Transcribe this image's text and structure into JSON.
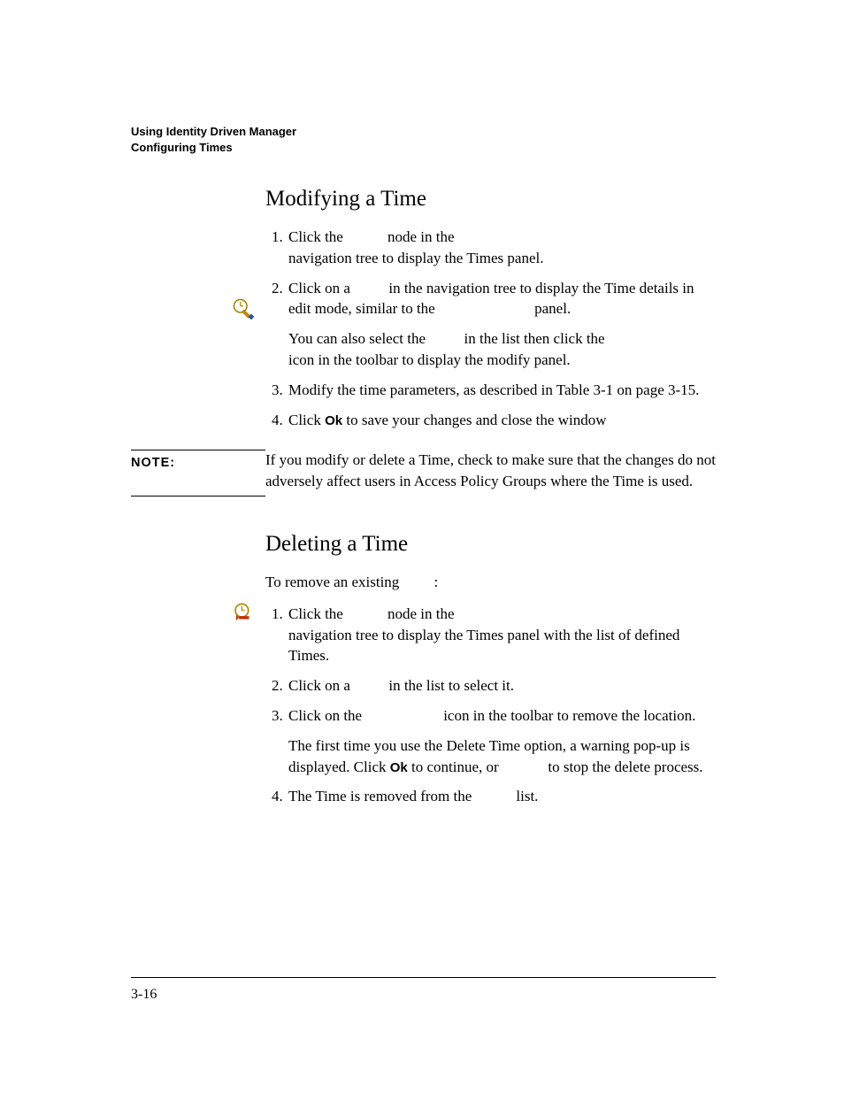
{
  "header": {
    "line1": "Using Identity Driven Manager",
    "line2": "Configuring Times"
  },
  "section1": {
    "heading": "Modifying a Time",
    "steps": {
      "s1a": "Click the ",
      "s1b": " node in the ",
      "s1c": " navigation tree to display the Times panel.",
      "s2a": "Click on a ",
      "s2b": " in the navigation tree to display the Time details in edit mode, similar to the ",
      "s2c": " panel.",
      "s2d": "You can also select the ",
      "s2e": " in the list then click the ",
      "s2f": " icon in the toolbar to display the modify panel.",
      "s3": "Modify the time parameters, as described in Table 3-1 on page 3-15.",
      "s4a": "Click ",
      "s4b": "Ok",
      "s4c": " to save your changes and close the window"
    }
  },
  "note": {
    "label": "NOTE:",
    "body": "If you modify or delete a Time, check to make sure that the changes do not adversely affect users in Access Policy Groups where the Time is used."
  },
  "section2": {
    "heading": "Deleting a Time",
    "intro_a": "To remove an existing ",
    "intro_b": ":",
    "steps": {
      "s1a": "Click the ",
      "s1b": " node in the ",
      "s1c": " navigation tree to display the Times panel with the list of defined Times.",
      "s2a": "Click on a ",
      "s2b": " in the list to select it.",
      "s3a": "Click on the ",
      "s3b": " icon in the toolbar to remove the location.",
      "s3c": "The first time you use the Delete Time option, a warning pop-up is displayed. Click ",
      "s3d": "Ok",
      "s3e": " to continue, or ",
      "s3f": " to stop the delete process.",
      "s4a": "The Time is removed from the ",
      "s4b": " list."
    }
  },
  "icons": {
    "modify": "modify-time-icon",
    "delete": "delete-time-icon"
  },
  "footer": {
    "page": "3-16"
  }
}
